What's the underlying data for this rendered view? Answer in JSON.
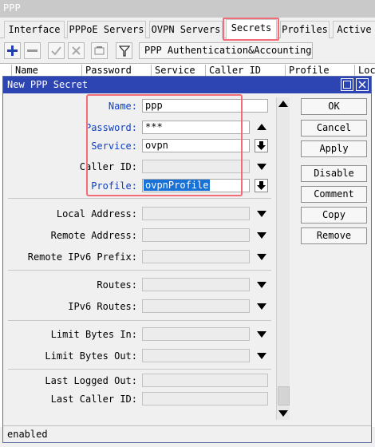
{
  "app": {
    "title": "PPP"
  },
  "tabs": [
    {
      "label": "Interface"
    },
    {
      "label": "PPPoE Servers"
    },
    {
      "label": "OVPN Servers"
    },
    {
      "label": "Secrets"
    },
    {
      "label": "Profiles"
    },
    {
      "label": "Active"
    }
  ],
  "toolbar": {
    "auth_button_label": "PPP Authentication&Accounting",
    "icons": [
      "add-icon",
      "remove-icon",
      "enable-check-icon",
      "disable-x-icon",
      "comment-icon",
      "filter-icon"
    ]
  },
  "list_columns": [
    "Name",
    "Password",
    "Service",
    "Caller ID",
    "Profile",
    "Loc"
  ],
  "dialog": {
    "title": "New PPP Secret",
    "fields": {
      "name": {
        "label": "Name:",
        "value": "ppp"
      },
      "password": {
        "label": "Password:",
        "value": "***"
      },
      "service": {
        "label": "Service:",
        "value": "ovpn"
      },
      "caller_id": {
        "label": "Caller ID:",
        "value": ""
      },
      "profile": {
        "label": "Profile:",
        "value": "ovpnProfile"
      },
      "local_address": {
        "label": "Local Address:",
        "value": ""
      },
      "remote_address": {
        "label": "Remote Address:",
        "value": ""
      },
      "remote_ipv6_prefix": {
        "label": "Remote IPv6 Prefix:",
        "value": ""
      },
      "routes": {
        "label": "Routes:",
        "value": ""
      },
      "ipv6_routes": {
        "label": "IPv6 Routes:",
        "value": ""
      },
      "limit_bytes_in": {
        "label": "Limit Bytes In:",
        "value": ""
      },
      "limit_bytes_out": {
        "label": "Limit Bytes Out:",
        "value": ""
      },
      "last_logged_out": {
        "label": "Last Logged Out:",
        "value": ""
      },
      "last_caller_id": {
        "label": "Last Caller ID:",
        "value": ""
      }
    },
    "buttons": {
      "ok": "OK",
      "cancel": "Cancel",
      "apply": "Apply",
      "disable": "Disable",
      "comment": "Comment",
      "copy": "Copy",
      "remove": "Remove"
    }
  },
  "status": {
    "text": "enabled"
  },
  "colors": {
    "dialog_title_bg": "#2d44b3",
    "field_label_blue": "#1040c0",
    "highlight_red": "#f26d78",
    "selection_blue": "#1871d6"
  }
}
